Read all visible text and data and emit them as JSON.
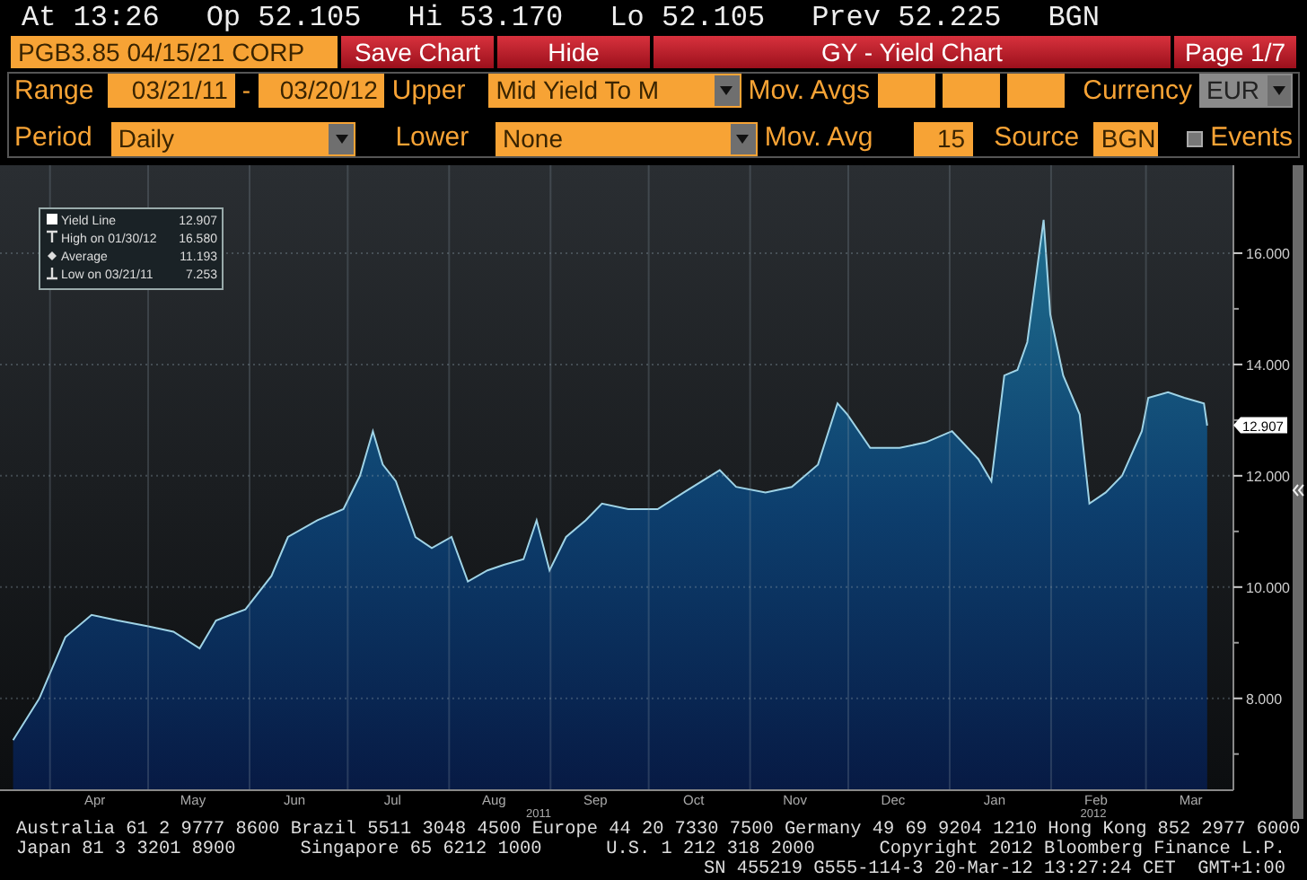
{
  "quote_bar": {
    "items": [
      "At 13:26",
      "Op 52.105",
      "Hi 53.170",
      "Lo 52.105",
      "Prev 52.225"
    ],
    "source": "BGN"
  },
  "toolbar": {
    "security": "PGB3.85 04/15/21 CORP",
    "buttons": [
      "Save Chart",
      "Hide"
    ],
    "title": "GY - Yield Chart",
    "page": "Page 1/7"
  },
  "options": {
    "range": {
      "label": "Range",
      "start": "03/21/11",
      "separator": "-",
      "end": "03/20/12"
    },
    "upper": {
      "label": "Upper",
      "value": "Mid Yield To M"
    },
    "mov_avgs": {
      "label": "Mov. Avgs"
    },
    "currency": {
      "label": "Currency",
      "value": "EUR",
      "disabled": true
    },
    "period": {
      "label": "Period",
      "value": "Daily"
    },
    "lower": {
      "label": "Lower",
      "value": "None"
    },
    "mov_avg": {
      "label": "Mov. Avg",
      "value": "15"
    },
    "source": {
      "label": "Source",
      "value": "BGN"
    },
    "events": {
      "label": "Events",
      "checked": false
    }
  },
  "chart": {
    "legend": [
      {
        "kind": "line",
        "label": "Yield Line",
        "value": "12.907"
      },
      {
        "kind": "high",
        "label": "High on 01/30/12",
        "value": "16.580"
      },
      {
        "kind": "average",
        "label": "Average",
        "value": "11.193"
      },
      {
        "kind": "low",
        "label": "Low on 03/21/11",
        "value": "7.253"
      }
    ],
    "last_value": "12.907",
    "year_labels": [
      "2011",
      "2012"
    ],
    "chart_data": {
      "type": "area",
      "grid": true,
      "xlim": [
        "2011-03-17",
        "2012-03-28"
      ],
      "ylim": [
        6.35,
        17.58
      ],
      "x": [
        "2011-03-21",
        "2011-03-29",
        "2011-04-06",
        "2011-04-14",
        "2011-04-22",
        "2011-05-01",
        "2011-05-09",
        "2011-05-17",
        "2011-05-22",
        "2011-05-31",
        "2011-06-08",
        "2011-06-13",
        "2011-06-22",
        "2011-06-30",
        "2011-07-05",
        "2011-07-09",
        "2011-07-12",
        "2011-07-16",
        "2011-07-22",
        "2011-07-27",
        "2011-08-02",
        "2011-08-07",
        "2011-08-13",
        "2011-08-18",
        "2011-08-24",
        "2011-08-28",
        "2011-09-01",
        "2011-09-06",
        "2011-09-12",
        "2011-09-17",
        "2011-09-25",
        "2011-10-04",
        "2011-10-12",
        "2011-10-23",
        "2011-10-28",
        "2011-11-06",
        "2011-11-14",
        "2011-11-22",
        "2011-11-28",
        "2011-12-01",
        "2011-12-08",
        "2011-12-17",
        "2011-12-25",
        "2012-01-02",
        "2012-01-10",
        "2012-01-14",
        "2012-01-18",
        "2012-01-22",
        "2012-01-25",
        "2012-01-30",
        "2012-02-01",
        "2012-02-05",
        "2012-02-10",
        "2012-02-13",
        "2012-02-18",
        "2012-02-23",
        "2012-02-29",
        "2012-03-02",
        "2012-03-08",
        "2012-03-13",
        "2012-03-19",
        "2012-03-20"
      ],
      "series": [
        {
          "color": "#9fd3e6",
          "values": [
            7.25,
            8.0,
            9.1,
            9.5,
            9.4,
            9.3,
            9.2,
            8.9,
            9.4,
            9.6,
            10.2,
            10.9,
            11.2,
            11.4,
            12.0,
            12.8,
            12.2,
            11.9,
            10.9,
            10.7,
            10.9,
            10.1,
            10.3,
            10.4,
            10.5,
            11.2,
            10.3,
            10.9,
            11.2,
            11.5,
            11.4,
            11.4,
            11.7,
            12.1,
            11.8,
            11.7,
            11.8,
            12.2,
            13.3,
            13.1,
            12.5,
            12.5,
            12.6,
            12.8,
            12.3,
            11.9,
            13.8,
            13.9,
            14.4,
            16.6,
            14.9,
            13.8,
            13.1,
            11.5,
            11.7,
            12.0,
            12.8,
            13.4,
            13.5,
            13.4,
            13.3,
            12.9
          ]
        }
      ],
      "xticks": [
        {
          "value": "2011-04-15",
          "label": "Apr"
        },
        {
          "value": "2011-05-15",
          "label": "May"
        },
        {
          "value": "2011-06-15",
          "label": "Jun"
        },
        {
          "value": "2011-07-15",
          "label": "Jul"
        },
        {
          "value": "2011-08-15",
          "label": "Aug"
        },
        {
          "value": "2011-09-15",
          "label": "Sep"
        },
        {
          "value": "2011-10-15",
          "label": "Oct"
        },
        {
          "value": "2011-11-15",
          "label": "Nov"
        },
        {
          "value": "2011-12-15",
          "label": "Dec"
        },
        {
          "value": "2012-01-15",
          "label": "Jan"
        },
        {
          "value": "2012-02-15",
          "label": "Feb"
        },
        {
          "value": "2012-03-15",
          "label": "Mar"
        }
      ],
      "yticks": [
        {
          "value": 8,
          "label": "8.000"
        },
        {
          "value": 10,
          "label": "10.000"
        },
        {
          "value": 12,
          "label": "12.000"
        },
        {
          "value": 14,
          "label": "14.000"
        },
        {
          "value": 16,
          "label": "16.000"
        }
      ]
    }
  },
  "footer": {
    "line_1": "Australia 61 2 9777 8600 Brazil 5511 3048 4500 Europe 44 20 7330 7500 Germany 49 69 9204 1210 Hong Kong 852 2977 6000",
    "line_2": [
      "Japan 81 3 3201 8900",
      "Singapore 65 6212 1000",
      "U.S. 1 212 318 2000",
      "Copyright 2012 Bloomberg Finance L.P."
    ],
    "line_3": "SN 455219 G555-114-3 20-Mar-12 13:27:24 CET  GMT+1:00"
  }
}
